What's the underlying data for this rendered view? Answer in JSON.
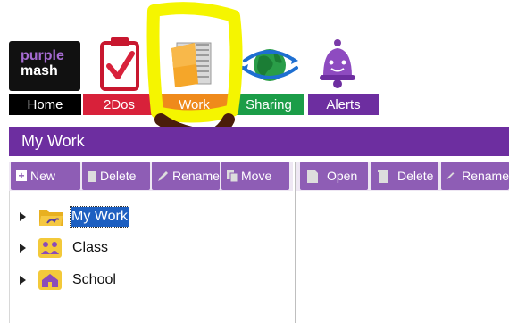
{
  "brand": {
    "line1": "purple",
    "line2": "mash"
  },
  "nav": {
    "home": "Home",
    "todos": "2Dos",
    "work": "Work",
    "sharing": "Sharing",
    "alerts": "Alerts"
  },
  "panel_title": "My Work",
  "left_toolbar": {
    "new": "New",
    "delete": "Delete",
    "rename": "Rename",
    "move": "Move"
  },
  "right_toolbar": {
    "open": "Open",
    "delete": "Delete",
    "rename": "Rename"
  },
  "tree": [
    {
      "label": "My Work",
      "selected": true
    },
    {
      "label": "Class"
    },
    {
      "label": "School"
    }
  ],
  "colors": {
    "purple": "#6d2ea0",
    "home": "#000000",
    "todos": "#d8213a",
    "work": "#ef8a1b",
    "sharing": "#1b9d48",
    "alerts": "#6d2ea0",
    "highlight": "#f5f500"
  }
}
